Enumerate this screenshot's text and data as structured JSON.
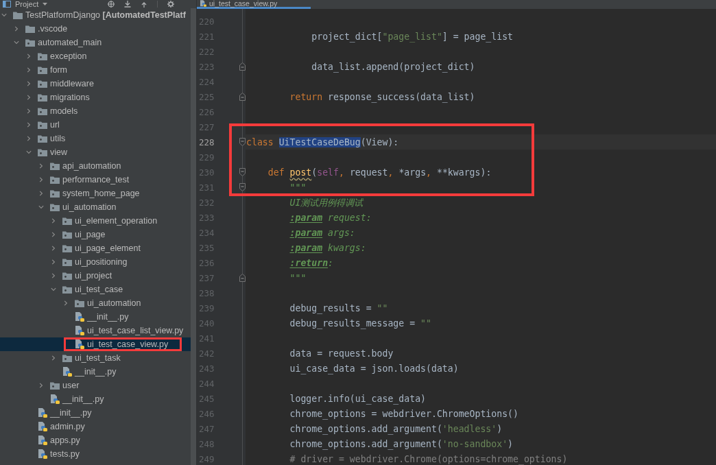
{
  "project_panel": {
    "title": "Project",
    "tree": [
      {
        "label": "TestPlatformDjango **[AutomatedTestPlatf**",
        "kind": "project",
        "expanded": true,
        "selected": false,
        "boxed": false,
        "children": [
          {
            "label": ".vscode",
            "kind": "folder",
            "expanded": false,
            "selected": false,
            "boxed": false
          },
          {
            "label": "automated_main",
            "kind": "package",
            "expanded": true,
            "selected": false,
            "boxed": false,
            "children": [
              {
                "label": "exception",
                "kind": "package",
                "expanded": false,
                "selected": false,
                "boxed": false
              },
              {
                "label": "form",
                "kind": "package",
                "expanded": false,
                "selected": false,
                "boxed": false
              },
              {
                "label": "middleware",
                "kind": "package",
                "expanded": false,
                "selected": false,
                "boxed": false
              },
              {
                "label": "migrations",
                "kind": "package",
                "expanded": false,
                "selected": false,
                "boxed": false
              },
              {
                "label": "models",
                "kind": "package",
                "expanded": false,
                "selected": false,
                "boxed": false
              },
              {
                "label": "url",
                "kind": "package",
                "expanded": false,
                "selected": false,
                "boxed": false
              },
              {
                "label": "utils",
                "kind": "package",
                "expanded": false,
                "selected": false,
                "boxed": false
              },
              {
                "label": "view",
                "kind": "package",
                "expanded": true,
                "selected": false,
                "boxed": false,
                "children": [
                  {
                    "label": "api_automation",
                    "kind": "package",
                    "expanded": false,
                    "selected": false,
                    "boxed": false
                  },
                  {
                    "label": "performance_test",
                    "kind": "package",
                    "expanded": false,
                    "selected": false,
                    "boxed": false
                  },
                  {
                    "label": "system_home_page",
                    "kind": "package",
                    "expanded": false,
                    "selected": false,
                    "boxed": false
                  },
                  {
                    "label": "ui_automation",
                    "kind": "package",
                    "expanded": true,
                    "selected": false,
                    "boxed": false,
                    "children": [
                      {
                        "label": "ui_element_operation",
                        "kind": "package",
                        "expanded": false,
                        "selected": false,
                        "boxed": false
                      },
                      {
                        "label": "ui_page",
                        "kind": "package",
                        "expanded": false,
                        "selected": false,
                        "boxed": false
                      },
                      {
                        "label": "ui_page_element",
                        "kind": "package",
                        "expanded": false,
                        "selected": false,
                        "boxed": false
                      },
                      {
                        "label": "ui_positioning",
                        "kind": "package",
                        "expanded": false,
                        "selected": false,
                        "boxed": false
                      },
                      {
                        "label": "ui_project",
                        "kind": "package",
                        "expanded": false,
                        "selected": false,
                        "boxed": false
                      },
                      {
                        "label": "ui_test_case",
                        "kind": "package",
                        "expanded": true,
                        "selected": false,
                        "boxed": false,
                        "children": [
                          {
                            "label": "ui_automation",
                            "kind": "package",
                            "expanded": false,
                            "selected": false,
                            "boxed": false
                          },
                          {
                            "label": "__init__.py",
                            "kind": "file",
                            "selected": false,
                            "boxed": false
                          },
                          {
                            "label": "ui_test_case_list_view.py",
                            "kind": "file",
                            "selected": false,
                            "boxed": false
                          },
                          {
                            "label": "ui_test_case_view.py",
                            "kind": "file",
                            "selected": true,
                            "boxed": true
                          }
                        ]
                      },
                      {
                        "label": "ui_test_task",
                        "kind": "package",
                        "expanded": false,
                        "selected": false,
                        "boxed": false
                      },
                      {
                        "label": "__init__.py",
                        "kind": "file",
                        "selected": false,
                        "boxed": false
                      }
                    ]
                  },
                  {
                    "label": "user",
                    "kind": "package",
                    "expanded": false,
                    "selected": false,
                    "boxed": false
                  },
                  {
                    "label": "__init__.py",
                    "kind": "file",
                    "selected": false,
                    "boxed": false
                  }
                ]
              },
              {
                "label": "__init__.py",
                "kind": "file",
                "selected": false,
                "boxed": false
              },
              {
                "label": "admin.py",
                "kind": "file",
                "selected": false,
                "boxed": false
              },
              {
                "label": "apps.py",
                "kind": "file",
                "selected": false,
                "boxed": false
              },
              {
                "label": "tests.py",
                "kind": "file",
                "selected": false,
                "boxed": false
              }
            ]
          }
        ]
      }
    ]
  },
  "editor": {
    "tab": {
      "label": "ui_test_case_view.py",
      "selected": true
    },
    "lines": [
      {
        "number": "220",
        "current": false,
        "fold_start": false,
        "fold_end": false,
        "boxed": false
      },
      {
        "number": "221",
        "current": false,
        "fold_start": false,
        "fold_end": false,
        "boxed": false,
        "tokens": [
          {
            "kind": "plain",
            "text": "            project_dict["
          },
          {
            "kind": "string",
            "text": "\"page_list\""
          },
          {
            "kind": "plain",
            "text": "] = page_list"
          }
        ]
      },
      {
        "number": "222",
        "current": false,
        "fold_start": false,
        "fold_end": false,
        "boxed": false
      },
      {
        "number": "223",
        "current": false,
        "fold_start": false,
        "fold_end": true,
        "boxed": false,
        "tokens": [
          {
            "kind": "plain",
            "text": "            data_list.append(project_dict)"
          }
        ]
      },
      {
        "number": "224",
        "current": false,
        "fold_start": false,
        "fold_end": false,
        "boxed": false
      },
      {
        "number": "225",
        "current": false,
        "fold_start": false,
        "fold_end": true,
        "boxed": false,
        "tokens": [
          {
            "kind": "keyword",
            "text": "        return"
          },
          {
            "kind": "plain",
            "text": " response_success(data_list)"
          }
        ]
      },
      {
        "number": "226",
        "current": false,
        "fold_start": false,
        "fold_end": false,
        "boxed": false
      },
      {
        "number": "227",
        "current": false,
        "fold_start": false,
        "fold_end": false,
        "boxed": false
      },
      {
        "number": "228",
        "current": true,
        "fold_start": true,
        "fold_end": false,
        "boxed": true,
        "tokens": [
          {
            "kind": "keyword",
            "text": "class "
          },
          {
            "kind": "selection",
            "text": "UiTestCaseDeBug"
          },
          {
            "kind": "plain",
            "text": "(View):"
          }
        ]
      },
      {
        "number": "229",
        "current": false,
        "fold_start": false,
        "fold_end": false,
        "boxed": true
      },
      {
        "number": "230",
        "current": false,
        "fold_start": true,
        "fold_end": false,
        "boxed": true,
        "tokens": [
          {
            "kind": "keyword",
            "text": "    def "
          },
          {
            "kind": "warning",
            "text": "post"
          },
          {
            "kind": "plain",
            "text": "("
          },
          {
            "kind": "self",
            "text": "self"
          },
          {
            "kind": "punct",
            "text": ","
          },
          {
            "kind": "plain",
            "text": " request"
          },
          {
            "kind": "punct",
            "text": ","
          },
          {
            "kind": "plain",
            "text": " *args"
          },
          {
            "kind": "punct",
            "text": ","
          },
          {
            "kind": "plain",
            "text": " **kwargs):"
          }
        ]
      },
      {
        "number": "231",
        "current": false,
        "fold_start": true,
        "fold_end": false,
        "boxed": true,
        "tokens": [
          {
            "kind": "doc",
            "text": "        \"\"\""
          }
        ]
      },
      {
        "number": "232",
        "current": false,
        "fold_start": false,
        "fold_end": false,
        "boxed": false,
        "tokens": [
          {
            "kind": "doc",
            "text": "        UI测试用例得调试"
          }
        ]
      },
      {
        "number": "233",
        "current": false,
        "fold_start": false,
        "fold_end": false,
        "boxed": false,
        "tokens": [
          {
            "kind": "doctag",
            "text": "        :param"
          },
          {
            "kind": "doc",
            "text": " request:"
          }
        ]
      },
      {
        "number": "234",
        "current": false,
        "fold_start": false,
        "fold_end": false,
        "boxed": false,
        "tokens": [
          {
            "kind": "doctag",
            "text": "        :param"
          },
          {
            "kind": "doc",
            "text": " args:"
          }
        ]
      },
      {
        "number": "235",
        "current": false,
        "fold_start": false,
        "fold_end": false,
        "boxed": false,
        "tokens": [
          {
            "kind": "doctag",
            "text": "        :param"
          },
          {
            "kind": "doc",
            "text": " kwargs:"
          }
        ]
      },
      {
        "number": "236",
        "current": false,
        "fold_start": false,
        "fold_end": false,
        "boxed": false,
        "tokens": [
          {
            "kind": "doctag",
            "text": "        :return"
          },
          {
            "kind": "doc",
            "text": ":"
          }
        ]
      },
      {
        "number": "237",
        "current": false,
        "fold_start": false,
        "fold_end": true,
        "boxed": false,
        "tokens": [
          {
            "kind": "doc",
            "text": "        \"\"\""
          }
        ]
      },
      {
        "number": "238",
        "current": false,
        "fold_start": false,
        "fold_end": false,
        "boxed": false
      },
      {
        "number": "239",
        "current": false,
        "fold_start": false,
        "fold_end": false,
        "boxed": false,
        "tokens": [
          {
            "kind": "plain",
            "text": "        debug_results = "
          },
          {
            "kind": "string",
            "text": "\"\""
          }
        ]
      },
      {
        "number": "240",
        "current": false,
        "fold_start": false,
        "fold_end": false,
        "boxed": false,
        "tokens": [
          {
            "kind": "plain",
            "text": "        debug_results_message = "
          },
          {
            "kind": "string",
            "text": "\"\""
          }
        ]
      },
      {
        "number": "241",
        "current": false,
        "fold_start": false,
        "fold_end": false,
        "boxed": false
      },
      {
        "number": "242",
        "current": false,
        "fold_start": false,
        "fold_end": false,
        "boxed": false,
        "tokens": [
          {
            "kind": "plain",
            "text": "        data = request.body"
          }
        ]
      },
      {
        "number": "243",
        "current": false,
        "fold_start": false,
        "fold_end": false,
        "boxed": false,
        "tokens": [
          {
            "kind": "plain",
            "text": "        ui_case_data = json.loads(data)"
          }
        ]
      },
      {
        "number": "244",
        "current": false,
        "fold_start": false,
        "fold_end": false,
        "boxed": false
      },
      {
        "number": "245",
        "current": false,
        "fold_start": false,
        "fold_end": false,
        "boxed": false,
        "tokens": [
          {
            "kind": "plain",
            "text": "        logger.info(ui_case_data)"
          }
        ]
      },
      {
        "number": "246",
        "current": false,
        "fold_start": false,
        "fold_end": false,
        "boxed": false,
        "tokens": [
          {
            "kind": "plain",
            "text": "        chrome_options = webdriver.ChromeOptions()"
          }
        ]
      },
      {
        "number": "247",
        "current": false,
        "fold_start": false,
        "fold_end": false,
        "boxed": false,
        "tokens": [
          {
            "kind": "plain",
            "text": "        chrome_options.add_argument("
          },
          {
            "kind": "string",
            "text": "'headless'"
          },
          {
            "kind": "plain",
            "text": ")"
          }
        ]
      },
      {
        "number": "248",
        "current": false,
        "fold_start": false,
        "fold_end": false,
        "boxed": false,
        "tokens": [
          {
            "kind": "plain",
            "text": "        chrome_options.add_argument("
          },
          {
            "kind": "string",
            "text": "'no-sandbox'"
          },
          {
            "kind": "plain",
            "text": ")"
          }
        ]
      },
      {
        "number": "249",
        "current": false,
        "fold_start": false,
        "fold_end": false,
        "boxed": false,
        "tokens": [
          {
            "kind": "comment",
            "text": "        # driver = webdriver.Chrome(options=chrome_options)"
          }
        ]
      }
    ]
  }
}
